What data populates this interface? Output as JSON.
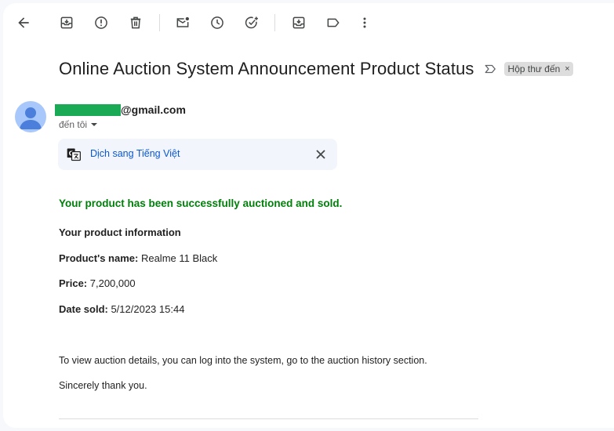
{
  "toolbar": {
    "icons": [
      "back-arrow-icon",
      "archive-icon",
      "report-spam-icon",
      "delete-icon",
      "mark-unread-icon",
      "snooze-icon",
      "add-to-tasks-icon",
      "move-to-icon",
      "label-icon",
      "more-icon"
    ]
  },
  "email": {
    "subject": "Online Auction System Announcement Product Status",
    "label_chip": "Hộp thư đến",
    "label_chip_close": "×",
    "sender": "@gmail.com",
    "to": "đến tôi",
    "translate": "Dịch sang Tiếng Việt"
  },
  "content": {
    "success_message": "Your product has been successfully auctioned and sold.",
    "info_heading": "Your product information",
    "name_label": "Product's name:",
    "name_value": " Realme 11 Black",
    "price_label": "Price:",
    "price_value": " 7,200,000",
    "date_label": "Date sold:",
    "date_value": " 5/12/2023 15:44",
    "details_text": "To view auction details, you can log into the system, go to the auction history section.",
    "closing": "Sincerely thank you."
  },
  "colors": {
    "success": "#00800a",
    "link": "#0b57d0",
    "avatar_bg": "#a8c7fa",
    "avatar_fg": "#4b7fdb",
    "redaction": "#1aaa55"
  }
}
